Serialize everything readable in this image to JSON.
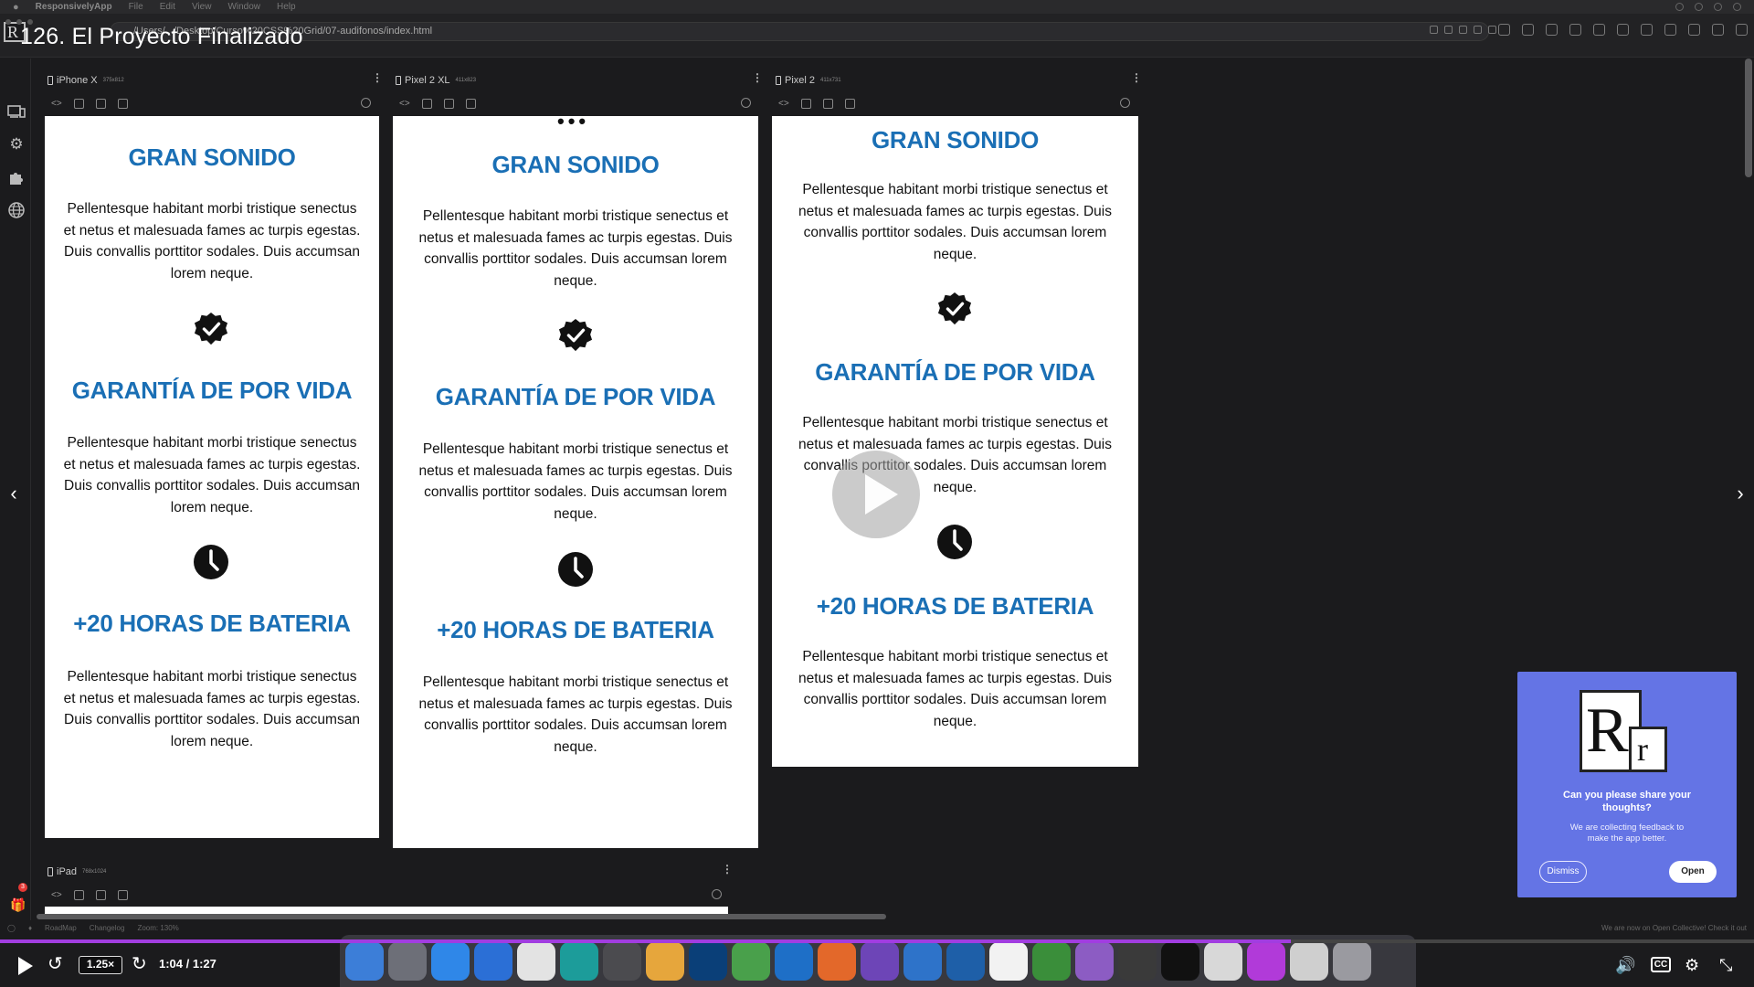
{
  "video": {
    "title": "126. El Proyecto Finalizado",
    "speed": "1.25×",
    "time": "1:04 / 1:27",
    "progress": 0.736,
    "cc_label": "CC"
  },
  "menubar": {
    "app_name": "ResponsivelyApp",
    "menu_items": [
      "File",
      "Edit",
      "View",
      "Window",
      "Help"
    ]
  },
  "address_bar": {
    "url": "/Users/.../Desktop/Curso%20CSS%20Grid/07-audifonos/index.html"
  },
  "devices": [
    {
      "name": "iPhone X",
      "dims": "375x812"
    },
    {
      "name": "Pixel 2 XL",
      "dims": "411x823"
    },
    {
      "name": "Pixel 2",
      "dims": "411x731"
    },
    {
      "name": "iPad",
      "dims": "768x1024"
    }
  ],
  "page": {
    "sections": [
      {
        "title": "GRAN SONIDO",
        "text": "Pellentesque habitant morbi tristique senectus et netus et malesuada fames ac turpis egestas. Duis convallis porttitor sodales. Duis accumsan lorem neque."
      },
      {
        "title": "GARANTÍA DE POR VIDA",
        "text": "Pellentesque habitant morbi tristique senectus et netus et malesuada fames ac turpis egestas. Duis convallis porttitor sodales. Duis accumsan lorem neque."
      },
      {
        "title": "+20 HORAS DE BATERIA",
        "text": "Pellentesque habitant morbi tristique senectus et netus et malesuada fames ac turpis egestas. Duis convallis porttitor sodales. Duis accumsan lorem neque."
      }
    ]
  },
  "feedback": {
    "question": "Can you please share your thoughts?",
    "subtext": "We are collecting feedback to make the app better.",
    "dismiss_label": "Dismiss",
    "open_label": "Open"
  },
  "statusbar": {
    "roadmap": "RoadMap",
    "changelog": "Changelog",
    "zoom": "Zoom: 130%",
    "notice": "We are now on Open Collective! Check it out"
  },
  "sidebar": {
    "notification_count": "3"
  },
  "colors": {
    "heading_blue": "#1a6fb5",
    "feedback_bg": "#6474e5",
    "progress": "#a13de0"
  }
}
